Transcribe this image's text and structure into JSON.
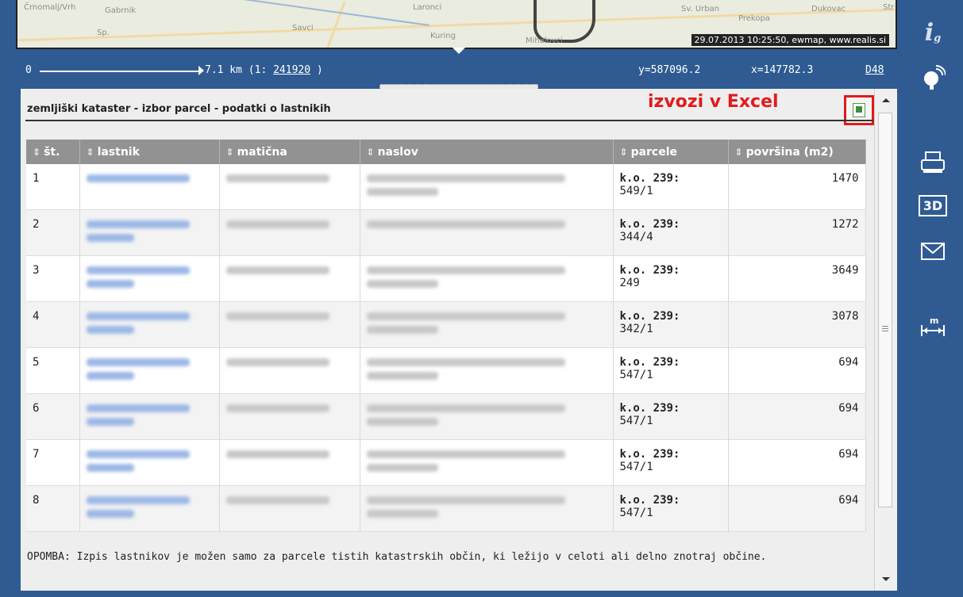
{
  "map": {
    "stamp": "29.07.2013 10:25:50, ewmap, www.realis.si",
    "place_labels": [
      "Črnomalj/Vrh",
      "Gabrnik",
      "Sp.",
      "Savci",
      "Laronci",
      "Kuring",
      "Sv. Urban",
      "Mihalovci",
      "Prekopa",
      "Dukovac",
      "Str"
    ]
  },
  "scale": {
    "zero": "0",
    "distance": "7.1 km (1: ",
    "ratio": "241920",
    "close": " )",
    "y": "y=587096.2",
    "x": "x=147782.3",
    "code": "D48"
  },
  "panel": {
    "title": "zemljiški kataster - izbor parcel - podatki o lastnikih",
    "export_label": "izvozi v Excel",
    "note": "OPOMBA: Izpis lastnikov je možen samo za parcele tistih katastrskih občin, ki ležijo v celoti ali delno znotraj občine."
  },
  "table": {
    "headers": [
      "št.",
      "lastnik",
      "matična",
      "naslov",
      "parcele",
      "površina (m2)"
    ],
    "rows": [
      {
        "no": "1",
        "ko": "k.o. 239:",
        "parcel": "549/1",
        "area": "1470"
      },
      {
        "no": "2",
        "ko": "k.o. 239:",
        "parcel": "344/4",
        "area": "1272"
      },
      {
        "no": "3",
        "ko": "k.o. 239:",
        "parcel": "249",
        "area": "3649"
      },
      {
        "no": "4",
        "ko": "k.o. 239:",
        "parcel": "342/1",
        "area": "3078"
      },
      {
        "no": "5",
        "ko": "k.o. 239:",
        "parcel": "547/1",
        "area": "694"
      },
      {
        "no": "6",
        "ko": "k.o. 239:",
        "parcel": "547/1",
        "area": "694"
      },
      {
        "no": "7",
        "ko": "k.o. 239:",
        "parcel": "547/1",
        "area": "694"
      },
      {
        "no": "8",
        "ko": "k.o. 239:",
        "parcel": "547/1",
        "area": "694"
      }
    ]
  },
  "toolbar": {
    "icons": [
      "ig-logo-icon",
      "satellite-icon",
      "print-icon",
      "3d-icon",
      "mail-icon",
      "measure-icon"
    ],
    "ig_label": "i",
    "ig_sub": "g",
    "three_d": "3D",
    "measure_unit": "m"
  },
  "colors": {
    "background": "#2f5b92",
    "header": "#929292",
    "link": "#9db8e6",
    "highlight": "#e21b1b"
  }
}
